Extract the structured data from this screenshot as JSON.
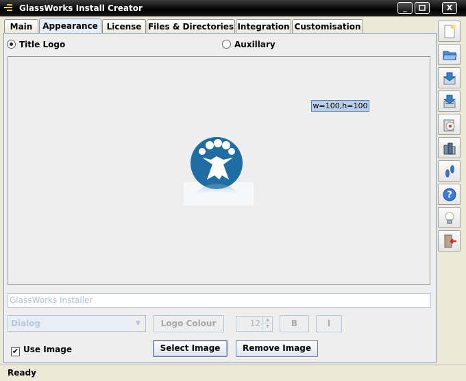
{
  "window": {
    "title": "GlassWorks Install Creator",
    "controls": [
      "_",
      "▫",
      "X"
    ]
  },
  "tabs": [
    {
      "label": "Main"
    },
    {
      "label": "Appearance"
    },
    {
      "label": "License"
    },
    {
      "label": "Files & Directories"
    },
    {
      "label": "Integration"
    },
    {
      "label": "Customisation"
    }
  ],
  "active_tab": "Appearance",
  "appearance": {
    "radio_title_logo": "Title Logo",
    "radio_auxillary": "Auxillary",
    "selected_radio": "Title Logo",
    "size_tag": "w=100,h=100",
    "title_text_value": "GlassWorks Installer",
    "font_combo_value": "Dialog",
    "logo_colour_button": "Logo Colour",
    "font_size_value": "12",
    "bold_button": "B",
    "italic_button": "I",
    "use_image_label": "Use Image",
    "use_image_checked": true,
    "select_image_button": "Select Image",
    "remove_image_button": "Remove Image"
  },
  "toolbar": {
    "icons": [
      "new-file-icon",
      "open-folder-icon",
      "save-icon",
      "save-as-icon",
      "build-cd-icon",
      "package-icon",
      "footprints-icon",
      "help-icon",
      "lightbulb-icon",
      "exit-icon"
    ]
  },
  "status": {
    "text": "Ready"
  },
  "colors": {
    "logo_blue": "#1f6ea3",
    "selection_blue": "#b8cfe5",
    "panel_border": "#7f9db9"
  }
}
